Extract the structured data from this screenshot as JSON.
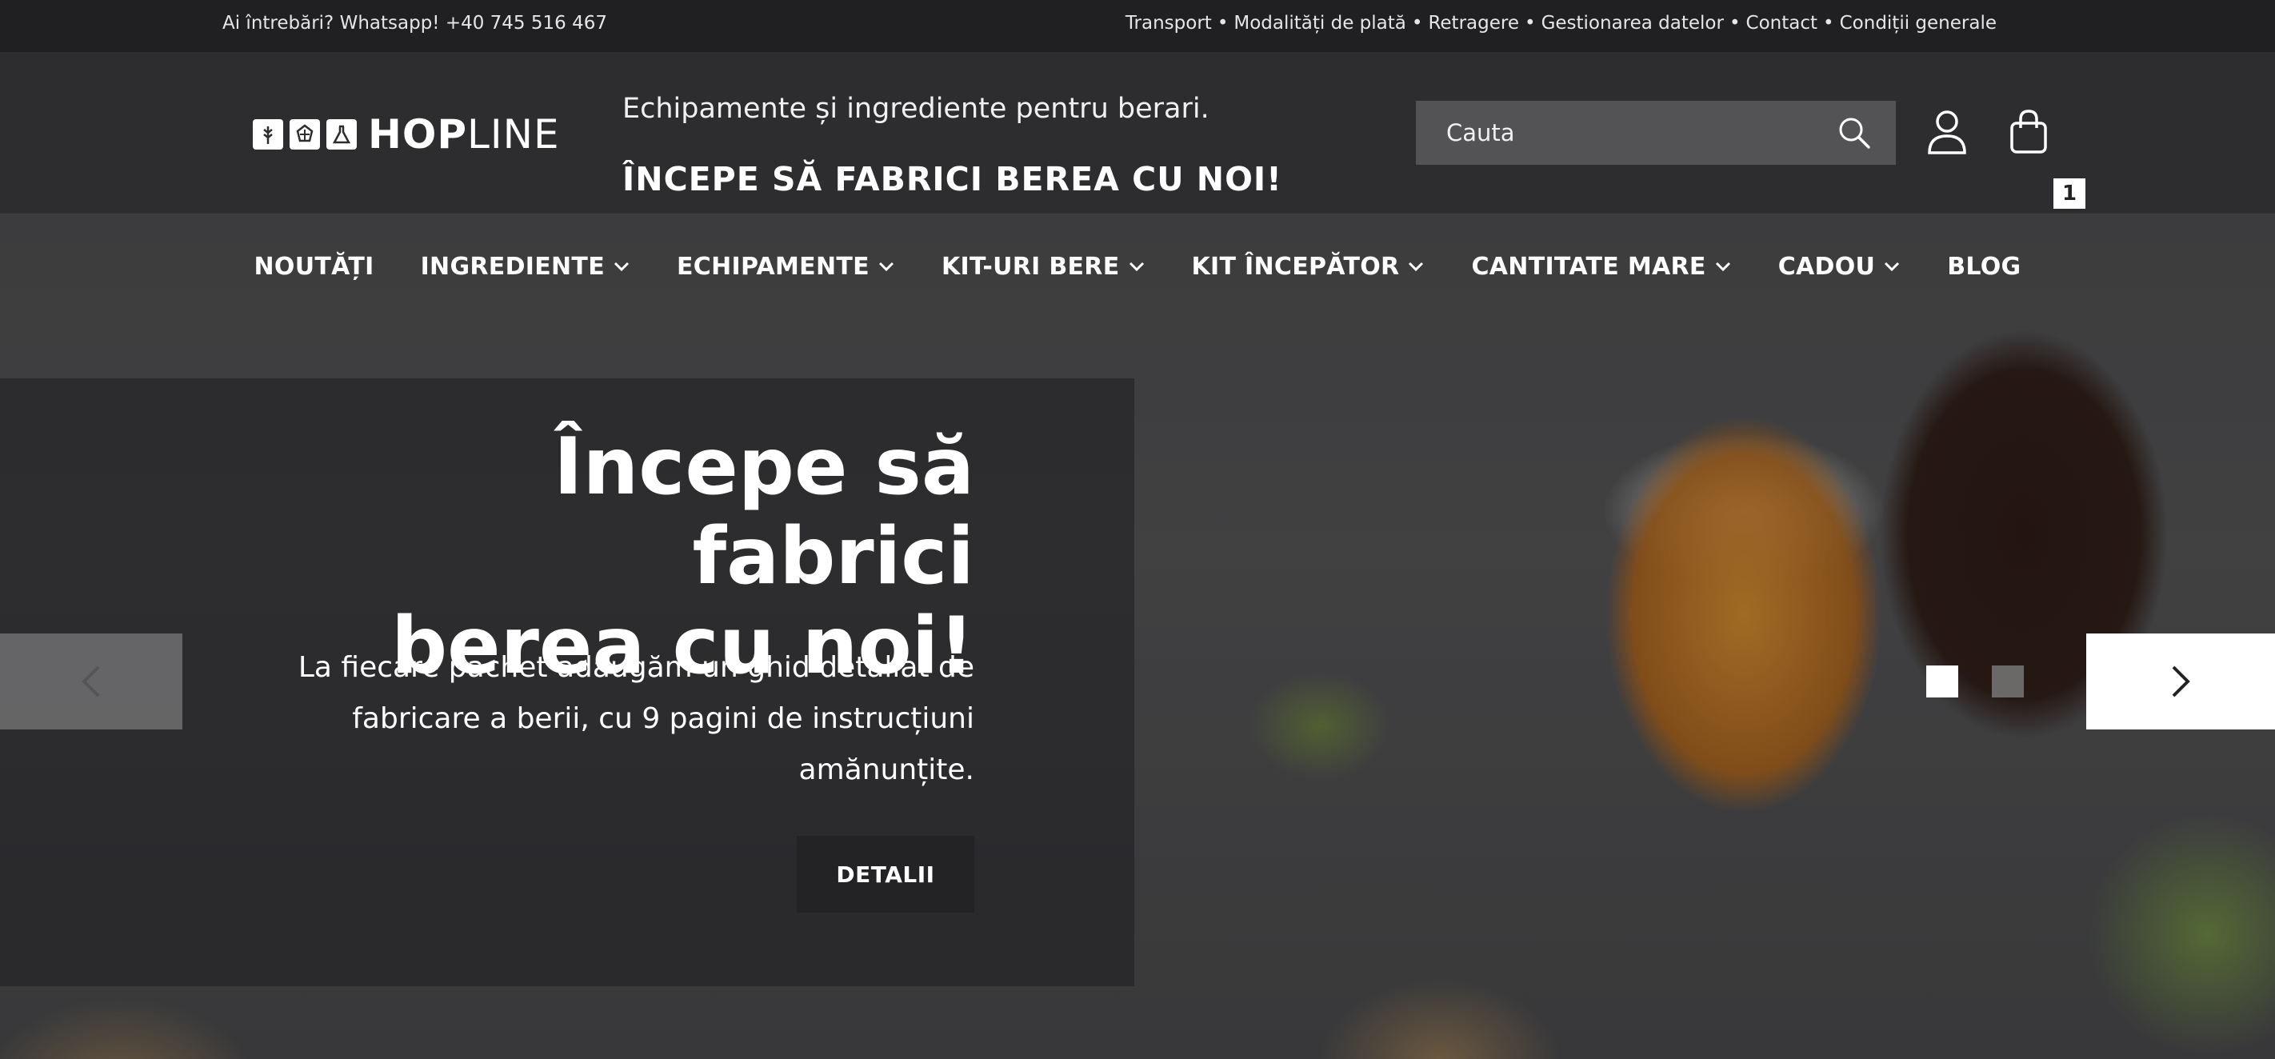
{
  "topbar": {
    "contact": "Ai întrebări? Whatsapp! +40 745 516 467",
    "links": [
      "Transport",
      "Modalități de plată",
      "Retragere",
      "Gestionarea datelor",
      "Contact",
      "Condiții generale"
    ],
    "separator": "•"
  },
  "header": {
    "logo": {
      "icons": [
        "wheat-icon",
        "hop-icon",
        "flask-icon"
      ],
      "word_bold": "HOP",
      "word_light": "LINE"
    },
    "tagline": "Echipamente și ingrediente pentru berari.",
    "slogan": "ÎNCEPE SĂ FABRICI BEREA CU NOI!",
    "search": {
      "placeholder": "Cauta",
      "value": ""
    },
    "cart_count": "1"
  },
  "nav": {
    "items": [
      {
        "label": "NOUTĂȚI",
        "dropdown": false
      },
      {
        "label": "INGREDIENTE",
        "dropdown": true
      },
      {
        "label": "ECHIPAMENTE",
        "dropdown": true
      },
      {
        "label": "KIT-URI BERE",
        "dropdown": true
      },
      {
        "label": "KIT ÎNCEPĂTOR",
        "dropdown": true
      },
      {
        "label": "CANTITATE MARE",
        "dropdown": true
      },
      {
        "label": "CADOU",
        "dropdown": true
      },
      {
        "label": "BLOG",
        "dropdown": false
      }
    ]
  },
  "hero": {
    "title_line1": "Începe să fabrici",
    "title_line2": "berea cu noi!",
    "text_line1": "La fiecare pachet adăugăm un ghid detaliat de",
    "text_line2": "fabricare a berii, cu 9 pagini de instrucțiuni",
    "text_line3": "amănunțite.",
    "button": "DETALII",
    "slides": 2,
    "active_slide": 1
  },
  "colors": {
    "topbar": "#202023",
    "header": "#2d2d30",
    "search": "#535356",
    "button": "#232325"
  }
}
